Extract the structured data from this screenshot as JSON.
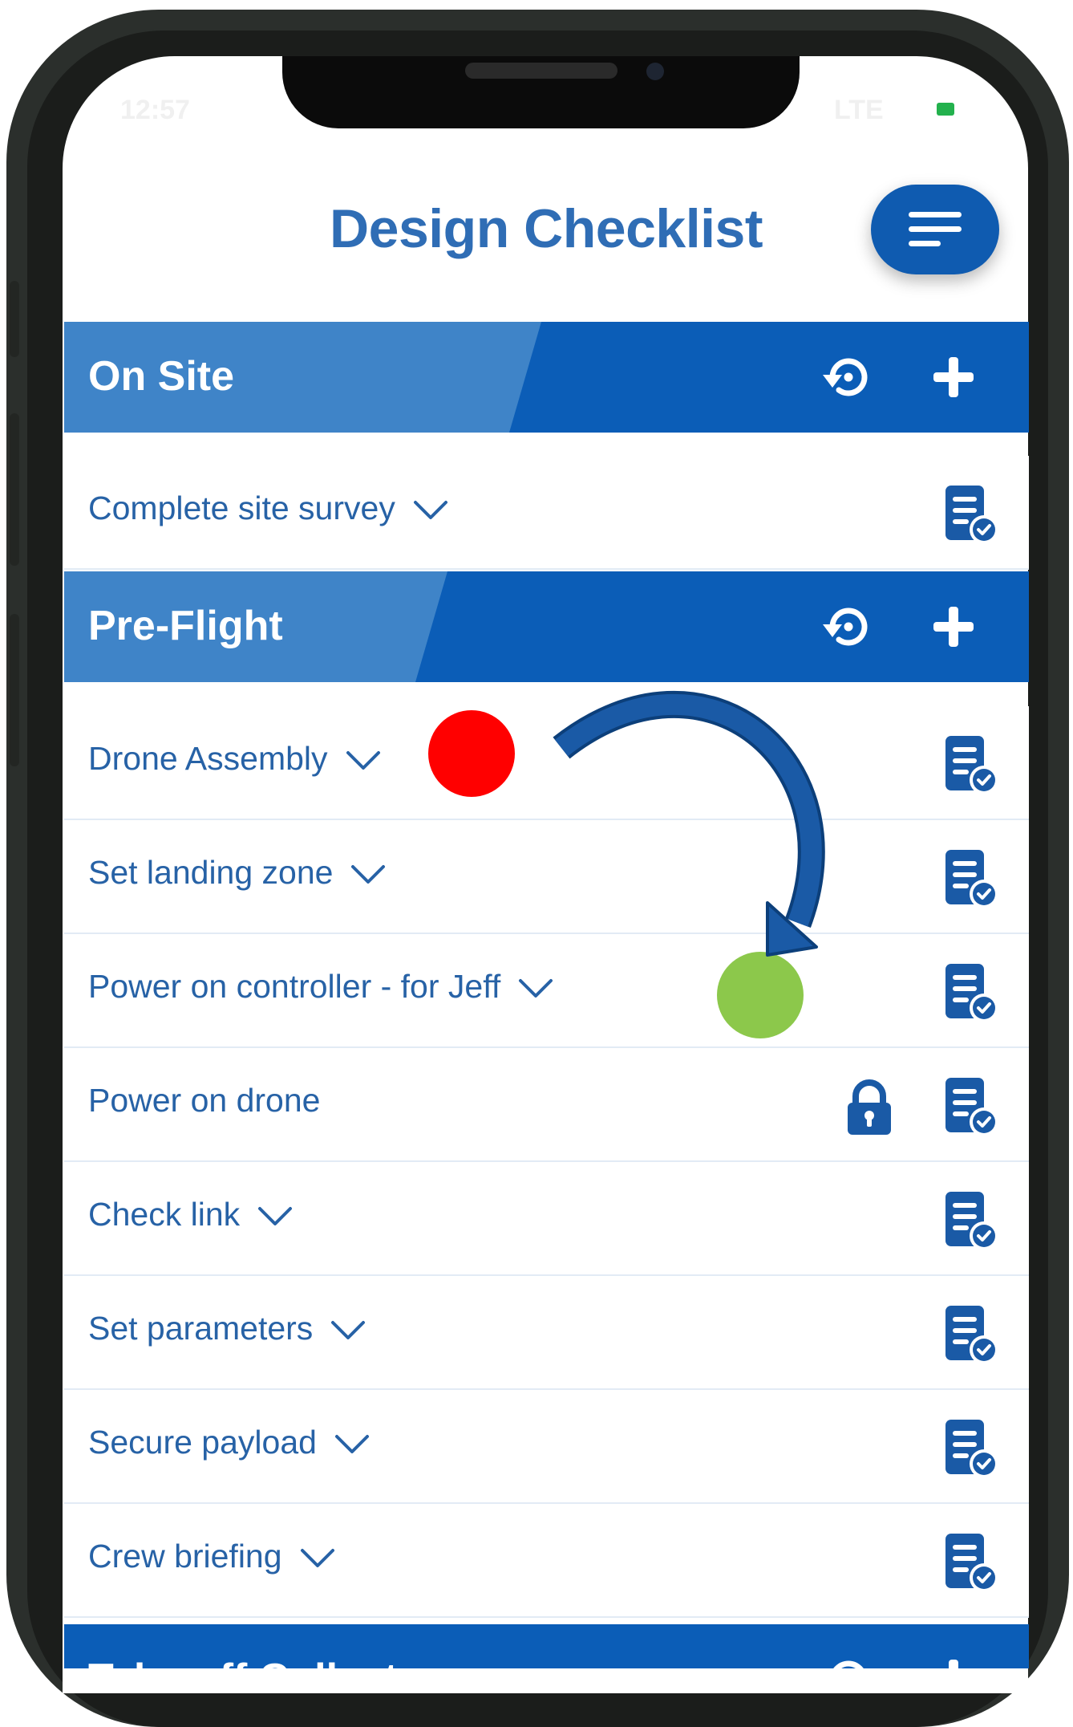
{
  "status_bar": {
    "time": "12:57",
    "signal": "LTE"
  },
  "header": {
    "title": "Design Checklist",
    "menu_icon": "hamburger-menu-icon"
  },
  "sections": [
    {
      "title": "On Site",
      "reset_icon": "reset-icon",
      "add_icon": "plus-icon",
      "items": [
        {
          "label": "Complete site survey",
          "expandable": true,
          "locked": false
        }
      ]
    },
    {
      "title": "Pre-Flight",
      "reset_icon": "reset-icon",
      "add_icon": "plus-icon",
      "items": [
        {
          "label": "Drone Assembly",
          "expandable": true,
          "locked": false
        },
        {
          "label": "Set landing zone",
          "expandable": true,
          "locked": false
        },
        {
          "label": "Power on controller - for Jeff",
          "expandable": true,
          "locked": false
        },
        {
          "label": "Power on drone",
          "expandable": false,
          "locked": true
        },
        {
          "label": "Check link",
          "expandable": true,
          "locked": false
        },
        {
          "label": "Set parameters",
          "expandable": true,
          "locked": false
        },
        {
          "label": "Secure payload",
          "expandable": true,
          "locked": false
        },
        {
          "label": "Crew briefing",
          "expandable": true,
          "locked": false
        }
      ]
    },
    {
      "title": "Take-off Collect",
      "reset_icon": "reset-icon",
      "add_icon": "plus-icon",
      "items": []
    }
  ],
  "annotations": {
    "start_marker_color": "#ff0000",
    "end_marker_color": "#8cc84b",
    "arrow_color": "#1a5aa6"
  },
  "colors": {
    "brand_blue": "#0b5db7",
    "header_light_blue": "#3f84c8",
    "title_blue": "#2f6db5",
    "item_text_blue": "#2762a6"
  }
}
